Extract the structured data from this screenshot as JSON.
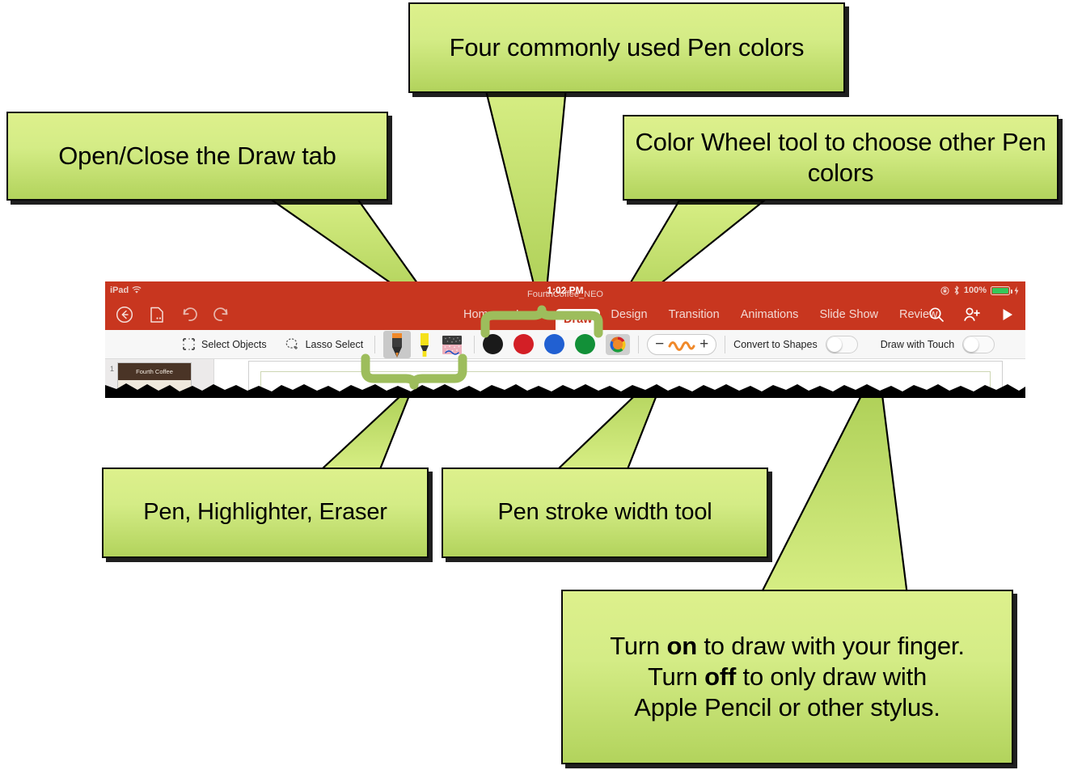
{
  "callouts": {
    "draw_tab": {
      "text": "Open/Close the Draw tab"
    },
    "pen_colors": {
      "text": "Four commonly used Pen colors"
    },
    "color_wheel": {
      "text": "Color Wheel tool to choose other Pen colors"
    },
    "pen_tools": {
      "text": "Pen, Highlighter, Eraser"
    },
    "stroke_width": {
      "text": "Pen stroke width tool"
    },
    "draw_touch_line1_a": "Turn ",
    "draw_touch_line1_b": "on",
    "draw_touch_line1_c": " to draw with your finger.",
    "draw_touch_line2_a": "Turn ",
    "draw_touch_line2_b": "off",
    "draw_touch_line2_c": " to only draw with",
    "draw_touch_line3": "Apple Pencil or other stylus."
  },
  "screenshot": {
    "statusbar": {
      "device": "iPad",
      "wifi_icon": "wifi-icon",
      "time": "1:02 PM",
      "doc_name": "FourthCoffee_NEO",
      "rotation_lock_icon": "rotation-lock-icon",
      "bluetooth_icon": "bluetooth-icon",
      "battery_percent": "100%",
      "battery_icon": "battery-full-icon",
      "charging_icon": "charging-bolt-icon"
    },
    "ribbon": {
      "back_icon": "back-arrow-icon",
      "file_icon": "file-menu-icon",
      "undo_icon": "undo-icon",
      "redo_icon": "redo-icon",
      "tabs": [
        {
          "label": "Home",
          "active": false
        },
        {
          "label": "Insert",
          "active": false
        },
        {
          "label": "Draw",
          "active": true
        },
        {
          "label": "Design",
          "active": false
        },
        {
          "label": "Transition",
          "active": false
        },
        {
          "label": "Animations",
          "active": false
        },
        {
          "label": "Slide Show",
          "active": false
        },
        {
          "label": "Review",
          "active": false
        }
      ],
      "search_icon": "search-icon",
      "share_icon": "add-person-icon",
      "play_icon": "play-slideshow-icon"
    },
    "toolbar": {
      "select_objects_label": "Select Objects",
      "select_objects_icon": "select-objects-icon",
      "lasso_select_label": "Lasso Select",
      "lasso_select_icon": "lasso-select-icon",
      "pen_tool_icon": "pen-icon",
      "highlighter_tool_icon": "highlighter-icon",
      "eraser_tool_icon": "eraser-icon",
      "colors": [
        {
          "name": "black",
          "hex": "#1a1a1a"
        },
        {
          "name": "red",
          "hex": "#d31f26"
        },
        {
          "name": "blue",
          "hex": "#2160d2"
        },
        {
          "name": "green",
          "hex": "#129038"
        }
      ],
      "color_wheel_icon": "color-wheel-icon",
      "width_minus_label": "−",
      "width_stroke_icon": "wavy-stroke-icon",
      "width_plus_label": "+",
      "convert_to_shapes_label": "Convert to Shapes",
      "convert_to_shapes_state": "off",
      "draw_with_touch_label": "Draw with Touch",
      "draw_with_touch_state": "off"
    },
    "slides": {
      "thumb_number": "1",
      "thumb_title": "Fourth Coffee"
    }
  },
  "colors": {
    "callout_fill_top": "#ddf08c",
    "callout_fill_bottom": "#b2d35c",
    "callout_border": "#0a0a0a",
    "brace_green": "#9dbd5c",
    "ppt_red": "#c8361f",
    "accent_orange": "#f0892a"
  }
}
